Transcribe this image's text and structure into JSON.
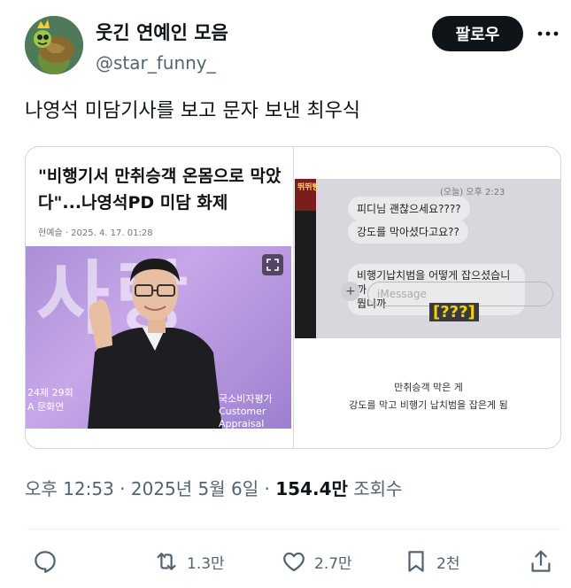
{
  "user": {
    "display_name": "웃긴 연예인 모음",
    "handle": "@star_funny_",
    "follow_label": "팔로우"
  },
  "tweet": {
    "text": "나영석 미담기사를 보고 문자 보낸 최우식"
  },
  "card": {
    "article_title": "\"비행기서 만취승객 온몸으로 막았다\"...나영석PD 미담 화제",
    "article_meta": "현예슬 · 2025. 4. 17. 01:28",
    "photo_bigtext": "사랑",
    "photo_logo_left": "24제 29회\nA 문화연",
    "photo_logo_right": "국소비자평가\nCustomer Appraisal",
    "tv_logo": "뛰뛰빵빵",
    "messages": {
      "time": "(오늘) 오후 2:23",
      "bubble1": "피디님 괜찮으세요????",
      "bubble2": "강도를 막아셨다고요??",
      "bubble3": "비행기납치범을 어떻게 잡으셨습니까",
      "bubble4": "뭡니까",
      "input_placeholder": "iMessage",
      "overlay": "[???]"
    },
    "caption_line1": "만취승객 막은 게",
    "caption_line2": "강도를 막고 비행기 납치범을 잡은게 됨"
  },
  "meta": {
    "time": "오후 12:53",
    "date": "2025년 5월 6일",
    "views_count": "154.4만",
    "views_label": "조회수"
  },
  "actions": {
    "retweets": "1.3만",
    "likes": "2.7만",
    "bookmarks": "2천"
  },
  "icons": {
    "reply": "reply-icon",
    "retweet": "retweet-icon",
    "like": "heart-icon",
    "bookmark": "bookmark-icon",
    "share": "share-icon",
    "more": "more-icon",
    "expand": "expand-icon"
  },
  "colors": {
    "text": "#0f1419",
    "secondary": "#536471",
    "follow_bg": "#0f1419",
    "border": "#cfd9de"
  }
}
